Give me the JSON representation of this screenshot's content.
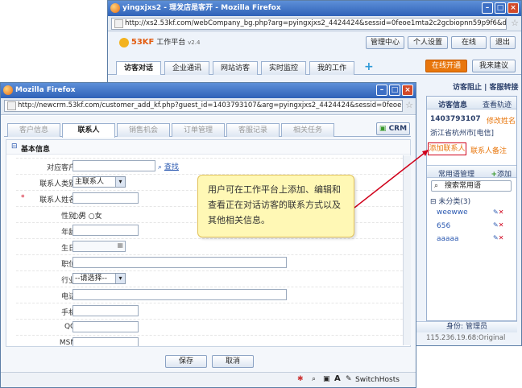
{
  "back_window": {
    "title": "yingxjxs2 - 理发店是客开 - Mozilla Firefox",
    "url": "http://xs2.53kf.com/webCompany_bg.php?arg=pyingxjxs2_4424424&sessid=0feoe1mta2c2gcbiopnn59p9f6&default_lang=cr",
    "logo": "53KF",
    "platform": "工作平台",
    "version": "v2.4",
    "header_buttons": [
      "管理中心",
      "个人设置",
      "在线",
      "退出"
    ],
    "tabs": [
      "访客对话",
      "企业通讯",
      "网站访客",
      "实时监控",
      "我的工作"
    ],
    "online_btn": "在线开通",
    "suggest_btn": "我来建议",
    "top_links": "访客阻止 | 客服转接",
    "visitor_info": "访客信息",
    "view_track": "查看轨迹",
    "visitor_id": "1403793107",
    "edit_name": "修改姓名",
    "location": "浙江省杭州市[电信]",
    "add_contact": "添加联系人",
    "contact_note": "联系人备注",
    "phrases_title": "常用语管理",
    "add": "添加",
    "search_placeholder": "搜索常用语",
    "category": "未分类(3)",
    "phrases": [
      "weewwe",
      "656",
      "aaaaa"
    ],
    "identity": "身份: 管理员",
    "status_ip": "115.236.19.68:Original"
  },
  "front_window": {
    "title": "Mozilla Firefox",
    "url": "http://newcrm.53kf.com/customer_add_kf.php?guest_id=1403793107&arg=pyingxjxs2_4424424&sessid=0feoe1mta2c2gcbi",
    "tabs": [
      "客户信息",
      "联系人",
      "销售机会",
      "订单管理",
      "客服记录",
      "相关任务"
    ],
    "crm": "CRM",
    "section": "基本信息",
    "fields": {
      "customer": "对应客户 :",
      "search": "查找",
      "contact_type": "联系人类别 :",
      "contact_type_value": "主联系人",
      "name": "联系人姓名 :",
      "gender": "性别 :",
      "male": "男",
      "female": "女",
      "age": "年龄 :",
      "birthday": "生日 :",
      "position": "职位 :",
      "industry": "行业 :",
      "industry_value": "--请选择--",
      "phone": "电话 :",
      "mobile": "手机 :",
      "qq": "QQ :",
      "msn": "MSN :"
    },
    "save": "保存",
    "cancel": "取消",
    "switchhosts": "SwitchHosts"
  },
  "callout": "用户可在工作平台上添加、编辑和查看正在对话访客的联系方式以及其他相关信息。",
  "colors": {
    "accent": "#2f62b8",
    "callout_bg": "#fff8b5",
    "red": "#d0021b",
    "orange": "#e8760c"
  }
}
